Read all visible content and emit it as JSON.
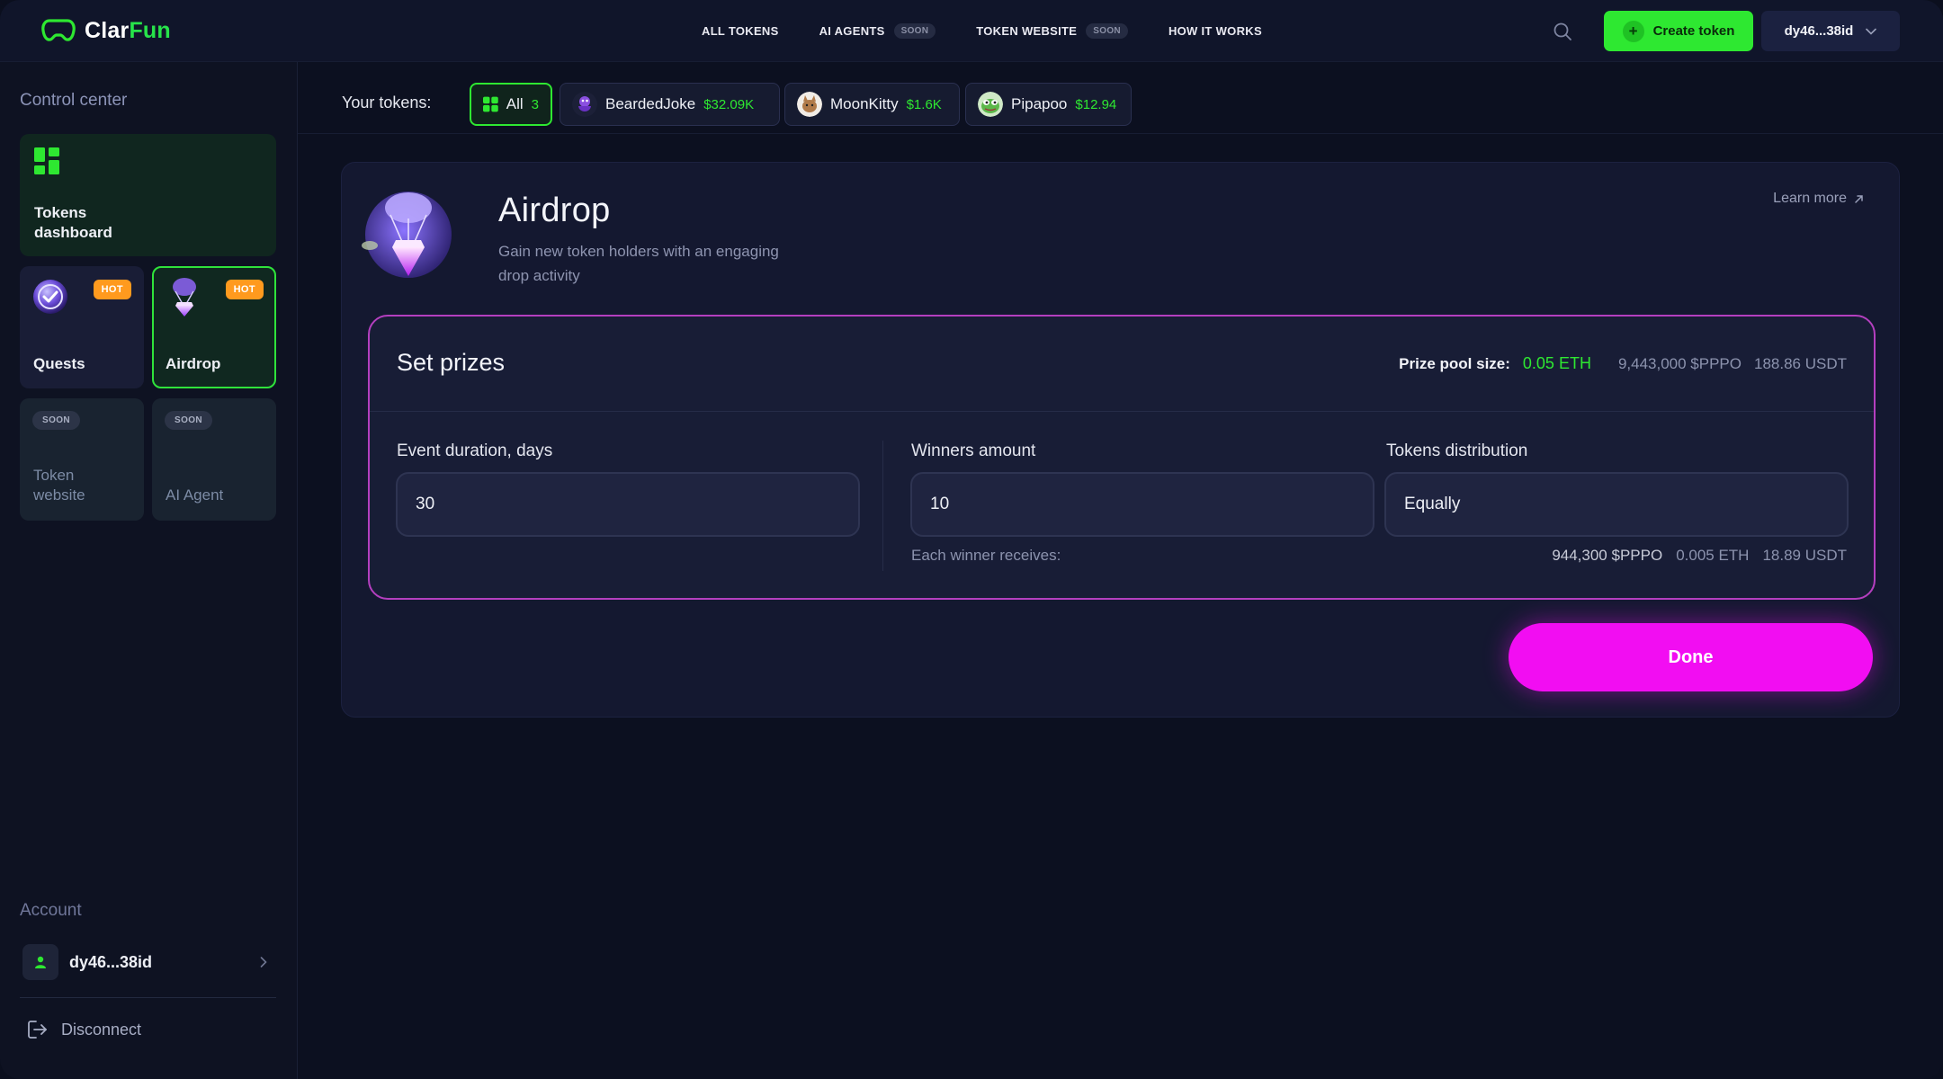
{
  "brand": {
    "name_part1": "Clar",
    "name_part2": "Fun",
    "accent": "#2ee831"
  },
  "nav": {
    "items": [
      {
        "label": "ALL TOKENS",
        "badge": ""
      },
      {
        "label": "AI AGENTS",
        "badge": "SOON"
      },
      {
        "label": "TOKEN WEBSITE",
        "badge": "SOON"
      },
      {
        "label": "HOW IT WORKS",
        "badge": ""
      }
    ],
    "create_label": "Create token",
    "wallet_label": "dy46...38id"
  },
  "sidebar": {
    "title": "Control center",
    "cards": {
      "dashboard": {
        "line1": "Tokens",
        "line2": "dashboard"
      },
      "quests": {
        "label": "Quests",
        "badge": "HOT"
      },
      "airdrop": {
        "label": "Airdrop",
        "badge": "HOT"
      },
      "website": {
        "line1": "Token",
        "line2": "website",
        "badge": "SOON"
      },
      "agent": {
        "label": "AI Agent",
        "badge": "SOON"
      }
    },
    "account_title": "Account",
    "account_name": "dy46...38id",
    "disconnect_label": "Disconnect"
  },
  "tokens": {
    "label": "Your tokens:",
    "all": {
      "label": "All",
      "count": "3"
    },
    "items": [
      {
        "name": "BeardedJoke",
        "value": "$32.09K",
        "icon": "bearded-joke-token-icon"
      },
      {
        "name": "MoonKitty",
        "value": "$1.6K",
        "icon": "moonkitty-token-icon"
      },
      {
        "name": "Pipapoo",
        "value": "$12.94",
        "icon": "pipapoo-token-icon"
      }
    ]
  },
  "panel": {
    "title": "Airdrop",
    "desc_line1": "Gain new token holders with an engaging",
    "desc_line2": "drop activity",
    "learn_more": "Learn more",
    "prizes": {
      "title": "Set prizes",
      "pool_label": "Prize pool size:",
      "pool_eth": "0.05 ETH",
      "pool_token": "9,443,000 $PPPO",
      "pool_usdt": "188.86 USDT",
      "duration_label": "Event duration, days",
      "duration_value": "30",
      "winners_label": "Winners amount",
      "winners_value": "10",
      "distribution_label": "Tokens distribution",
      "distribution_value": "Equally",
      "each_label": "Each winner receives:",
      "each_token": "944,300 $PPPO",
      "each_eth": "0.005 ETH",
      "each_usdt": "18.89 USDT"
    },
    "done_label": "Done"
  }
}
